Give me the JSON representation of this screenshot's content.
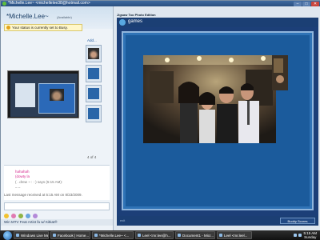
{
  "window": {
    "title": "*Michelle.Lee~ <michellelee38@hotmail.com>",
    "controls": [
      "–",
      "□",
      "✕"
    ]
  },
  "contact": {
    "name": "*Michelle.Lee~",
    "status": "(Available)",
    "busy_notice": "Your status is currently set to Busy.",
    "add_link": "Add...",
    "page_counter": "4 of 4"
  },
  "conversation": {
    "messages": [
      {
        "text": "hahahah",
        "style": "pink"
      },
      {
        "text": "(dowty la",
        "style": "pink"
      },
      {
        "text": "( . drew ~ : : ) says (5:15 AM):",
        "style": "gray"
      },
      {
        "text": "– –",
        "style": "gray"
      }
    ],
    "last_received": "Last message received at 5:15 AM on 8/23/2009."
  },
  "ad_bar": {
    "text": "Win MTV Feat Artist fa w/ Kitkat®"
  },
  "game": {
    "title": "Jigsaw Too Photo Edition",
    "section": "games",
    "footer_left": "exit",
    "brand": "Buddy Scores"
  },
  "taskbar": {
    "tasks": [
      "Windows Live Me...",
      "Facebook | Home...",
      "*Michelle.Lee~ <...",
      "Leel <mr.lee@h...",
      "Document1 - Micr...",
      "Leel <mr.leel..."
    ],
    "clock": {
      "time": "5:15 AM",
      "day": "Sunday"
    }
  },
  "colors": {
    "accent": "#1b3f74",
    "board": "#1b5b9c",
    "message_pink": "#d62a8f",
    "busy_banner": "#fff7c9"
  }
}
